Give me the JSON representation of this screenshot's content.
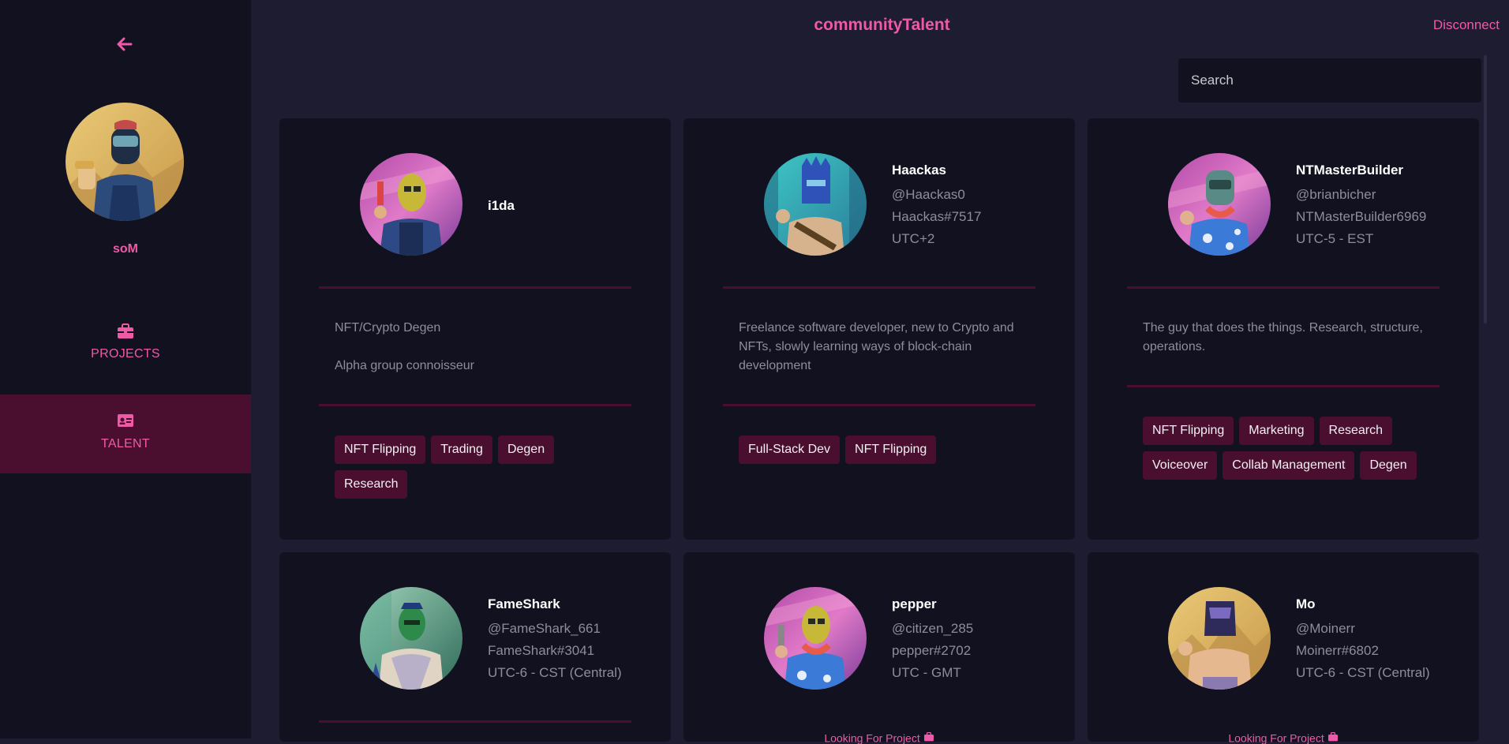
{
  "header": {
    "title": "communityTalent",
    "disconnect_label": "Disconnect"
  },
  "search": {
    "placeholder": "Search"
  },
  "sidebar": {
    "profile_name": "soM",
    "nav": [
      {
        "label": "PROJECTS",
        "icon": "briefcase-icon",
        "active": false
      },
      {
        "label": "TALENT",
        "icon": "id-card-icon",
        "active": true
      }
    ]
  },
  "colors": {
    "accent": "#ee5aa8",
    "tag_bg": "#4a0f2e",
    "card_bg": "#12111f",
    "page_bg": "#1d1c31",
    "sidebar_bg": "#12111f"
  },
  "cards": [
    {
      "name": "i1da",
      "bio": [
        "NFT/Crypto Degen",
        "Alpha group connoisseur"
      ],
      "tags": [
        "NFT Flipping",
        "Trading",
        "Degen",
        "Research"
      ]
    },
    {
      "name": "Haackas",
      "handle": "@Haackas0",
      "discord": "Haackas#7517",
      "timezone": "UTC+2",
      "bio": [
        "Freelance software developer, new to Crypto and NFTs, slowly learning ways of block-chain development"
      ],
      "tags": [
        "Full-Stack Dev",
        "NFT Flipping"
      ]
    },
    {
      "name": "NTMasterBuilder",
      "handle": "@brianbicher",
      "discord": "NTMasterBuilder6969",
      "timezone": "UTC-5 - EST",
      "bio": [
        "The guy that does the things. Research, structure, operations."
      ],
      "tags": [
        "NFT Flipping",
        "Marketing",
        "Research",
        "Voiceover",
        "Collab Management",
        "Degen"
      ]
    },
    {
      "name": "FameShark",
      "handle": "@FameShark_661",
      "discord": "FameShark#3041",
      "timezone": "UTC-6 - CST (Central)"
    },
    {
      "name": "pepper",
      "handle": "@citizen_285",
      "discord": "pepper#2702",
      "timezone": "UTC - GMT",
      "status": "Looking For Project"
    },
    {
      "name": "Mo",
      "handle": "@Moinerr",
      "discord": "Moinerr#6802",
      "timezone": "UTC-6 - CST (Central)",
      "status": "Looking For Project"
    }
  ]
}
